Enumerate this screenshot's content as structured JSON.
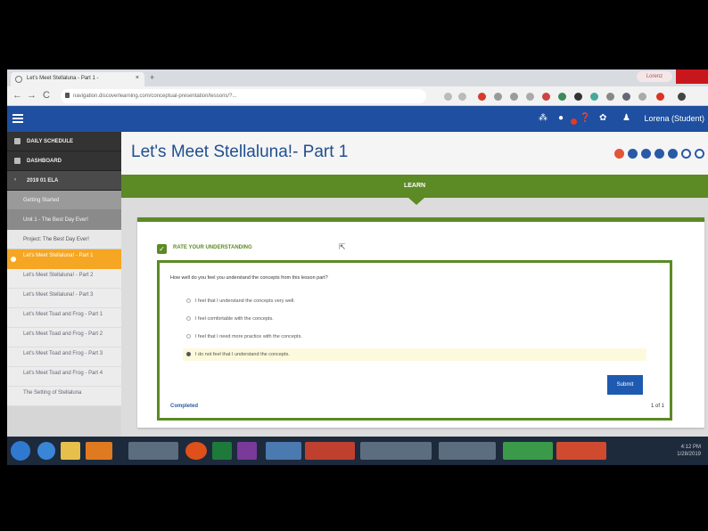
{
  "browser": {
    "tab_title": "Let's Meet Stellaluna - Part 1 -",
    "tab_close": "×",
    "new_tab": "+",
    "url": "navigation.discoverlearning.com/conceptual-presentation/lessons/?...",
    "profile": "Lorenz",
    "back": "←",
    "forward": "→",
    "reload": "C"
  },
  "appbar": {
    "user": "Lorena (Student)"
  },
  "sidebar": {
    "daily_schedule": "DAILY SCHEDULE",
    "dashboard": "DASHBOARD",
    "course": "2019 01 ELA",
    "getting_started": "Getting Started",
    "unit": "Unit 1 - The Best Day Ever!",
    "project": "Project: The Best Day Ever!",
    "items": [
      "Let's Meet Stellaluna! - Part 1",
      "Let's Meet Stellaluna! - Part 2",
      "Let's Meet Stellaluna! - Part 3",
      "Let's Meet Toad and Frog - Part 1",
      "Let's Meet Toad and Frog - Part 2",
      "Let's Meet Toad and Frog - Part 3",
      "Let's Meet Toad and Frog - Part 4",
      "The Setting of Stellaluna"
    ]
  },
  "main": {
    "title": "Let's Meet Stellaluna!- Part 1",
    "learn_label": "LEARN",
    "rate_header": "RATE YOUR UNDERSTANDING",
    "question": "How well do you feel you understand the concepts from this lesson part?",
    "options": [
      "I feel that I understand the concepts very well.",
      "I feel comfortable with the concepts.",
      "I feel that I need more practice with the concepts.",
      "I do not feel that I understand the concepts."
    ],
    "selected_option_index": 3,
    "submit_label": "Submit",
    "status": "Completed",
    "pager": "1 of 1"
  },
  "taskbar": {
    "time": "4:12 PM",
    "date": "1/28/2019"
  },
  "colors": {
    "app_blue": "#1e4fa0",
    "learn_green": "#5c8a25",
    "active_orange": "#f5a623"
  }
}
